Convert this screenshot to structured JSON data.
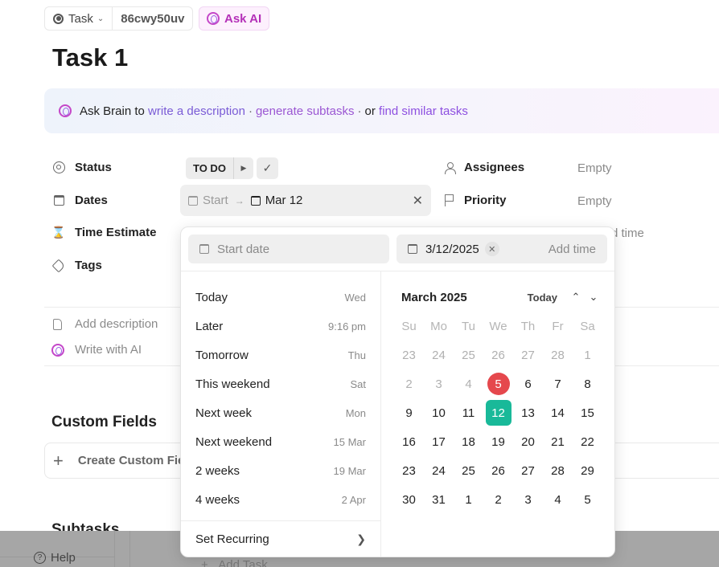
{
  "breadcrumb": {
    "type_label": "Task",
    "task_id": "86cwy50uv",
    "ask_ai_label": "Ask AI"
  },
  "task": {
    "title": "Task 1"
  },
  "banner": {
    "prefix": "Ask Brain to",
    "link1": "write a description",
    "sep1": "·",
    "link2": "generate subtasks",
    "sep2": "·",
    "or": "or",
    "link3": "find similar tasks"
  },
  "fields": {
    "status": {
      "label": "Status",
      "value": "TO DO"
    },
    "dates": {
      "label": "Dates",
      "start_placeholder": "Start",
      "due_value": "Mar 12"
    },
    "time_estimate": {
      "label": "Time Estimate",
      "partial_value": "d time"
    },
    "tags": {
      "label": "Tags"
    },
    "assignees": {
      "label": "Assignees",
      "value": "Empty"
    },
    "priority": {
      "label": "Priority",
      "value": "Empty"
    }
  },
  "description": {
    "add_label": "Add description",
    "ai_label": "Write with AI"
  },
  "custom_fields": {
    "heading": "Custom Fields",
    "create_label": "Create Custom Fie"
  },
  "subtasks": {
    "heading": "Subtasks",
    "add_label": "Add Task"
  },
  "footer": {
    "help_label": "Help"
  },
  "picker": {
    "start_placeholder": "Start date",
    "due_value": "3/12/2025",
    "add_time_label": "Add time",
    "quick_options": [
      {
        "label": "Today",
        "hint": "Wed"
      },
      {
        "label": "Later",
        "hint": "9:16 pm"
      },
      {
        "label": "Tomorrow",
        "hint": "Thu"
      },
      {
        "label": "This weekend",
        "hint": "Sat"
      },
      {
        "label": "Next week",
        "hint": "Mon"
      },
      {
        "label": "Next weekend",
        "hint": "15 Mar"
      },
      {
        "label": "2 weeks",
        "hint": "19 Mar"
      },
      {
        "label": "4 weeks",
        "hint": "2 Apr"
      }
    ],
    "recurring_label": "Set Recurring",
    "calendar": {
      "month_label": "March 2025",
      "today_label": "Today",
      "weekdays": [
        "Su",
        "Mo",
        "Tu",
        "We",
        "Th",
        "Fr",
        "Sa"
      ],
      "today_day": 5,
      "selected_day": 12,
      "weeks": [
        [
          {
            "d": "23",
            "m": true
          },
          {
            "d": "24",
            "m": true
          },
          {
            "d": "25",
            "m": true
          },
          {
            "d": "26",
            "m": true
          },
          {
            "d": "27",
            "m": true
          },
          {
            "d": "28",
            "m": true
          },
          {
            "d": "1",
            "m": true
          }
        ],
        [
          {
            "d": "2",
            "m": true
          },
          {
            "d": "3",
            "m": true
          },
          {
            "d": "4",
            "m": true
          },
          {
            "d": "5",
            "s": "today"
          },
          {
            "d": "6"
          },
          {
            "d": "7"
          },
          {
            "d": "8"
          }
        ],
        [
          {
            "d": "9"
          },
          {
            "d": "10"
          },
          {
            "d": "11"
          },
          {
            "d": "12",
            "s": "sel"
          },
          {
            "d": "13"
          },
          {
            "d": "14"
          },
          {
            "d": "15"
          }
        ],
        [
          {
            "d": "16"
          },
          {
            "d": "17"
          },
          {
            "d": "18"
          },
          {
            "d": "19"
          },
          {
            "d": "20"
          },
          {
            "d": "21"
          },
          {
            "d": "22"
          }
        ],
        [
          {
            "d": "23"
          },
          {
            "d": "24"
          },
          {
            "d": "25"
          },
          {
            "d": "26"
          },
          {
            "d": "27"
          },
          {
            "d": "28"
          },
          {
            "d": "29"
          }
        ],
        [
          {
            "d": "30"
          },
          {
            "d": "31"
          },
          {
            "d": "1"
          },
          {
            "d": "2"
          },
          {
            "d": "3"
          },
          {
            "d": "4"
          },
          {
            "d": "5"
          }
        ]
      ]
    }
  },
  "colors": {
    "today_marker": "#e5484d",
    "selected_marker": "#19b999",
    "ai_accent": "#b430b8"
  }
}
